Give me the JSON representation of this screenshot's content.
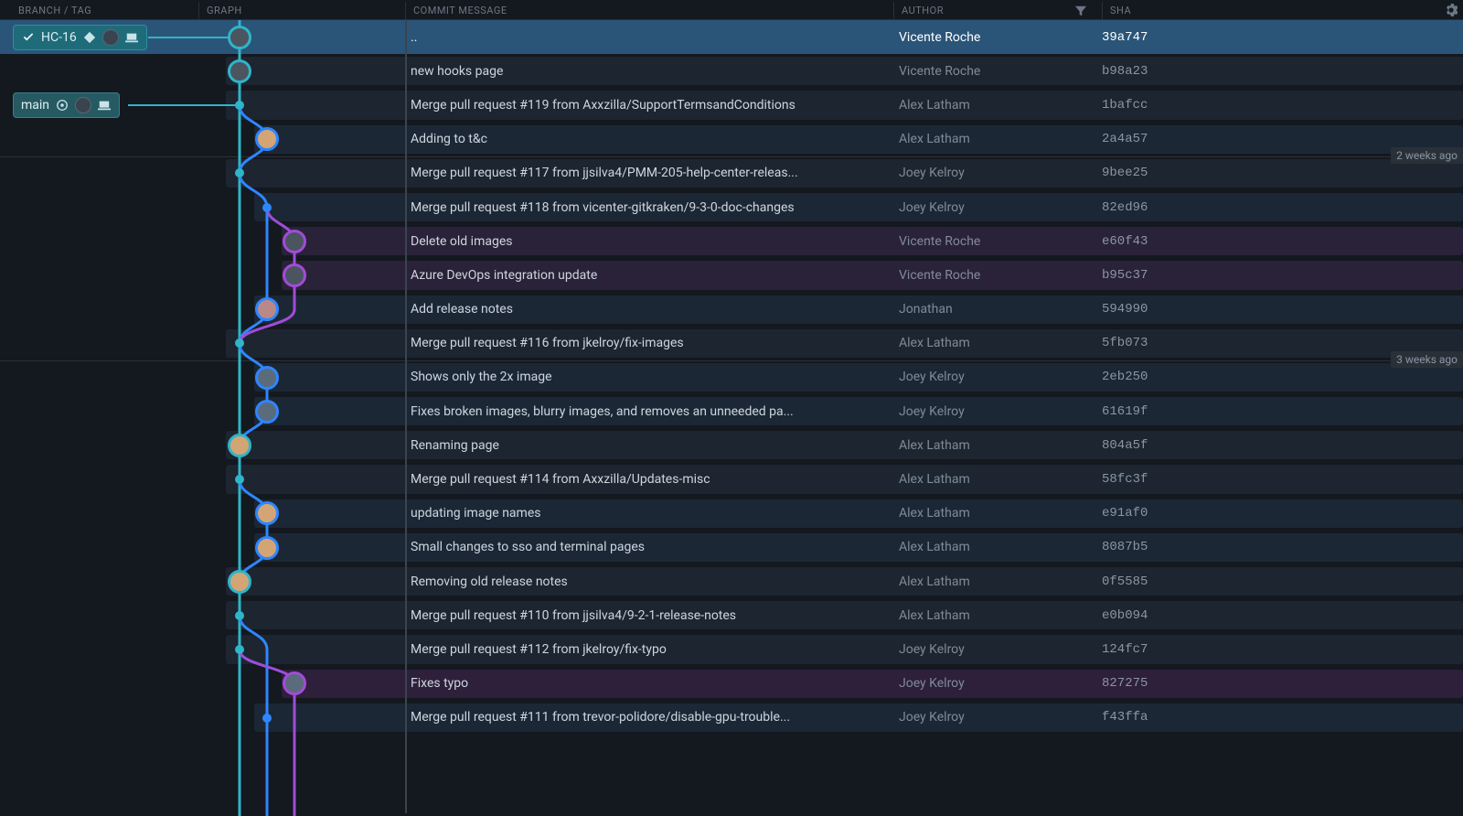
{
  "headers": {
    "branch": "BRANCH / TAG",
    "graph": "GRAPH",
    "message": "COMMIT MESSAGE",
    "author": "AUTHOR",
    "sha": "SHA"
  },
  "branches": {
    "hc16": "HC-16",
    "main": "main"
  },
  "time_markers": [
    {
      "label": "2 weeks ago",
      "row": 3
    },
    {
      "label": "3 weeks ago",
      "row": 9
    }
  ],
  "commits": [
    {
      "message": "..",
      "author": "Vicente Roche",
      "sha": "39a747",
      "selected": true,
      "lane": 0,
      "node": "avatar",
      "color": "teal"
    },
    {
      "message": "new hooks page",
      "author": "Vicente Roche",
      "sha": "b98a23",
      "lane": 0,
      "node": "avatar",
      "color": "teal"
    },
    {
      "message": "Merge pull request #119 from Axxzilla/SupportTermsandConditions",
      "author": "Alex Latham",
      "sha": "1bafcc",
      "lane": 0,
      "node": "dot",
      "color": "teal"
    },
    {
      "message": "Adding to t&c",
      "author": "Alex Latham",
      "sha": "2a4a57",
      "lane": 1,
      "node": "avatar",
      "color": "blue"
    },
    {
      "message": "Merge pull request #117 from jjsilva4/PMM-205-help-center-releas...",
      "author": "Joey Kelroy",
      "sha": "9bee25",
      "lane": 0,
      "node": "dot",
      "color": "teal"
    },
    {
      "message": "Merge pull request #118 from vicenter-gitkraken/9-3-0-doc-changes",
      "author": "Joey Kelroy",
      "sha": "82ed96",
      "lane": 1,
      "node": "dot",
      "color": "blue"
    },
    {
      "message": "Delete old images",
      "author": "Vicente Roche",
      "sha": "e60f43",
      "lane": 2,
      "node": "avatar",
      "color": "purple"
    },
    {
      "message": "Azure DevOps integration update",
      "author": "Vicente Roche",
      "sha": "b95c37",
      "lane": 2,
      "node": "avatar",
      "color": "purple"
    },
    {
      "message": "Add release notes",
      "author": "Jonathan",
      "sha": "594990",
      "lane": 1,
      "node": "avatar",
      "color": "blue"
    },
    {
      "message": "Merge pull request #116 from jkelroy/fix-images",
      "author": "Alex Latham",
      "sha": "5fb073",
      "lane": 0,
      "node": "dot",
      "color": "teal"
    },
    {
      "message": "Shows only the 2x image",
      "author": "Joey Kelroy",
      "sha": "2eb250",
      "lane": 1,
      "node": "avatar",
      "color": "blue"
    },
    {
      "message": "Fixes broken images, blurry images, and removes an unneeded pa...",
      "author": "Joey Kelroy",
      "sha": "61619f",
      "lane": 1,
      "node": "avatar",
      "color": "blue"
    },
    {
      "message": "Renaming page",
      "author": "Alex Latham",
      "sha": "804a5f",
      "lane": 0,
      "node": "avatar",
      "color": "teal"
    },
    {
      "message": "Merge pull request #114 from Axxzilla/Updates-misc",
      "author": "Alex Latham",
      "sha": "58fc3f",
      "lane": 0,
      "node": "dot",
      "color": "teal"
    },
    {
      "message": "updating image names",
      "author": "Alex Latham",
      "sha": "e91af0",
      "lane": 1,
      "node": "avatar",
      "color": "blue"
    },
    {
      "message": "Small changes to sso and terminal pages",
      "author": "Alex Latham",
      "sha": "8087b5",
      "lane": 1,
      "node": "avatar",
      "color": "blue"
    },
    {
      "message": "Removing old release notes",
      "author": "Alex Latham",
      "sha": "0f5585",
      "lane": 0,
      "node": "avatar",
      "color": "teal"
    },
    {
      "message": "Merge pull request #110 from jjsilva4/9-2-1-release-notes",
      "author": "Alex Latham",
      "sha": "e0b094",
      "lane": 0,
      "node": "dot",
      "color": "teal"
    },
    {
      "message": "Merge pull request #112 from jkelroy/fix-typo",
      "author": "Joey Kelroy",
      "sha": "124fc7",
      "lane": 0,
      "node": "dot",
      "color": "teal"
    },
    {
      "message": "Fixes typo",
      "author": "Joey Kelroy",
      "sha": "827275",
      "lane": 2,
      "node": "avatar",
      "color": "purple",
      "laneClass": "lane2b"
    },
    {
      "message": "Merge pull request #111 from trevor-polidore/disable-gpu-trouble...",
      "author": "Joey Kelroy",
      "sha": "f43ffa",
      "lane": 1,
      "node": "dot",
      "color": "blue"
    }
  ],
  "graph": {
    "lane_x": [
      45,
      75,
      105
    ],
    "row_h": 37.2,
    "row_offset": 18.6
  }
}
